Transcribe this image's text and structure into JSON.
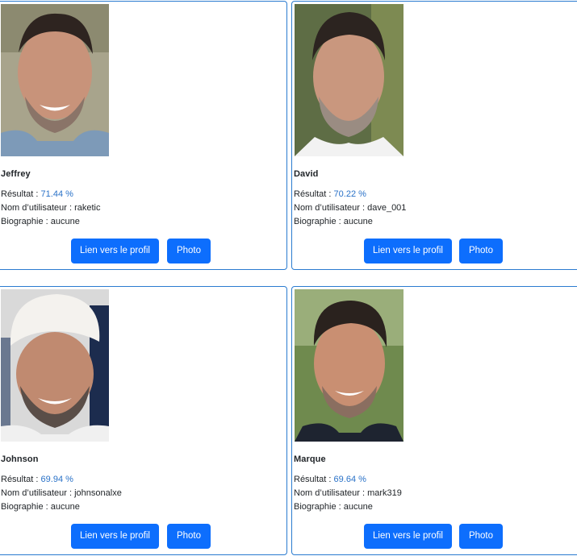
{
  "labels": {
    "result_prefix": "Résultat : ",
    "username_prefix": "Nom d’utilisateur : ",
    "bio_prefix": "Biographie : ",
    "profile_button": "Lien vers le profil",
    "photo_button": "Photo"
  },
  "cards": [
    {
      "name": "Jeffrey",
      "score": "71.44 %",
      "username": "raketic",
      "bio": "aucune"
    },
    {
      "name": "David",
      "score": "70.22 %",
      "username": "dave_001",
      "bio": "aucune"
    },
    {
      "name": "Johnson",
      "score": "69.94 %",
      "username": "johnsonalxe",
      "bio": "aucune"
    },
    {
      "name": "Marque",
      "score": "69.64 %",
      "username": "mark319",
      "bio": "aucune"
    }
  ],
  "colors": {
    "card_border": "#2a7bd0",
    "button_bg": "#0d6efd",
    "score_text": "#2a72c8"
  }
}
